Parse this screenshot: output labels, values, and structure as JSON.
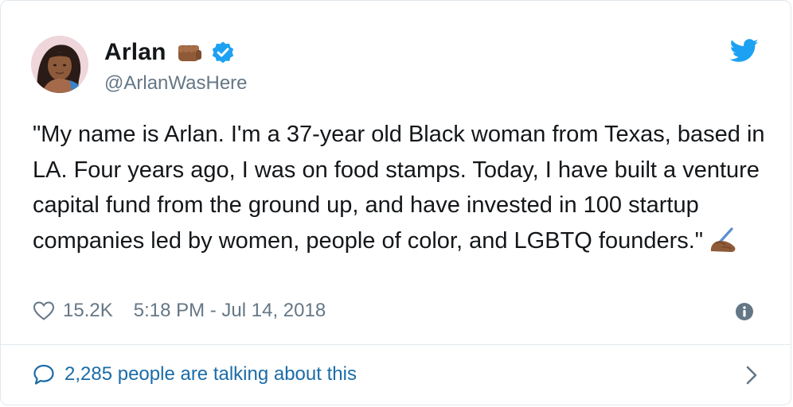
{
  "tweet": {
    "author": {
      "display_name": "Arlan",
      "handle": "@ArlanWasHere",
      "name_emoji": "fist-bump-medium-dark-skin",
      "verified": true,
      "avatar": "profile-photo"
    },
    "platform_icon": "twitter-bird-icon",
    "text": "\"My name is Arlan. I'm a 37-year old Black woman from Texas, based in LA. Four years ago, I was on food stamps. Today, I have built a venture capital fund from the ground up, and have invested in 100 startup companies led by women, people of color, and LGBTQ founders.\"",
    "text_emoji": "writing-hand-medium-dark-skin",
    "likes": "15.2K",
    "timestamp": "5:18 PM - Jul 14, 2018",
    "conversation": "2,285 people are talking about this"
  },
  "colors": {
    "text": "#14171a",
    "secondary": "#657786",
    "link": "#1b6ca8",
    "twitter_blue": "#1da1f2",
    "border": "#e1e8ed"
  }
}
